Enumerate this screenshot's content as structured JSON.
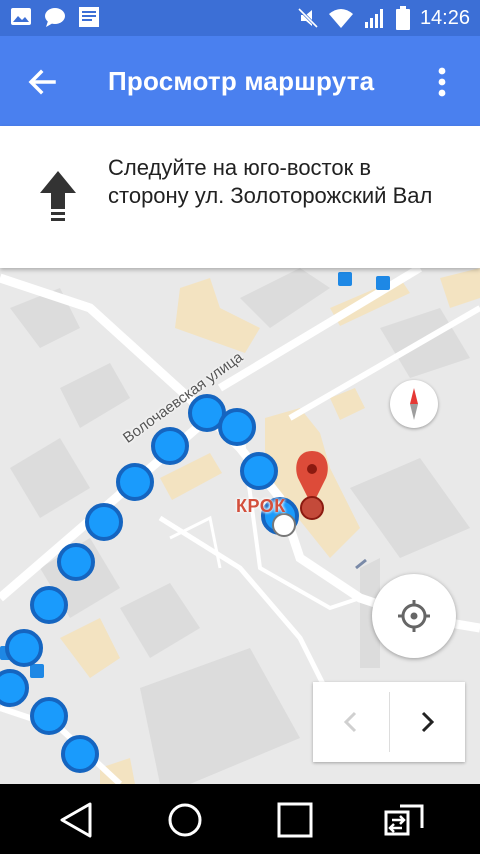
{
  "status_bar": {
    "time": "14:26",
    "left_icons": [
      "image-icon",
      "chat-icon",
      "news-icon"
    ],
    "right_icons": [
      "mute-icon",
      "wifi-icon",
      "signal-icon",
      "battery-icon"
    ]
  },
  "app_bar": {
    "title": "Просмотр маршрута",
    "back_icon": "back-arrow-icon",
    "menu_icon": "more-vert-icon"
  },
  "instruction": {
    "text": "Следуйте на юго-восток в сторону ул. Золоторожский Вал",
    "icon": "straight-arrow-icon"
  },
  "map": {
    "street_label": "Волочаевская улица",
    "place_label": "КРОК",
    "route_color": "#1a9bfc",
    "route_outline": "#1565c0",
    "pin_color": "#dd4b39"
  },
  "controls": {
    "compass_icon": "compass-icon",
    "locate_icon": "my-location-icon",
    "prev_icon": "chevron-left-icon",
    "next_icon": "chevron-right-icon"
  },
  "nav_bar": {
    "icons": [
      "back-icon",
      "home-icon",
      "recents-icon",
      "switch-icon"
    ]
  }
}
